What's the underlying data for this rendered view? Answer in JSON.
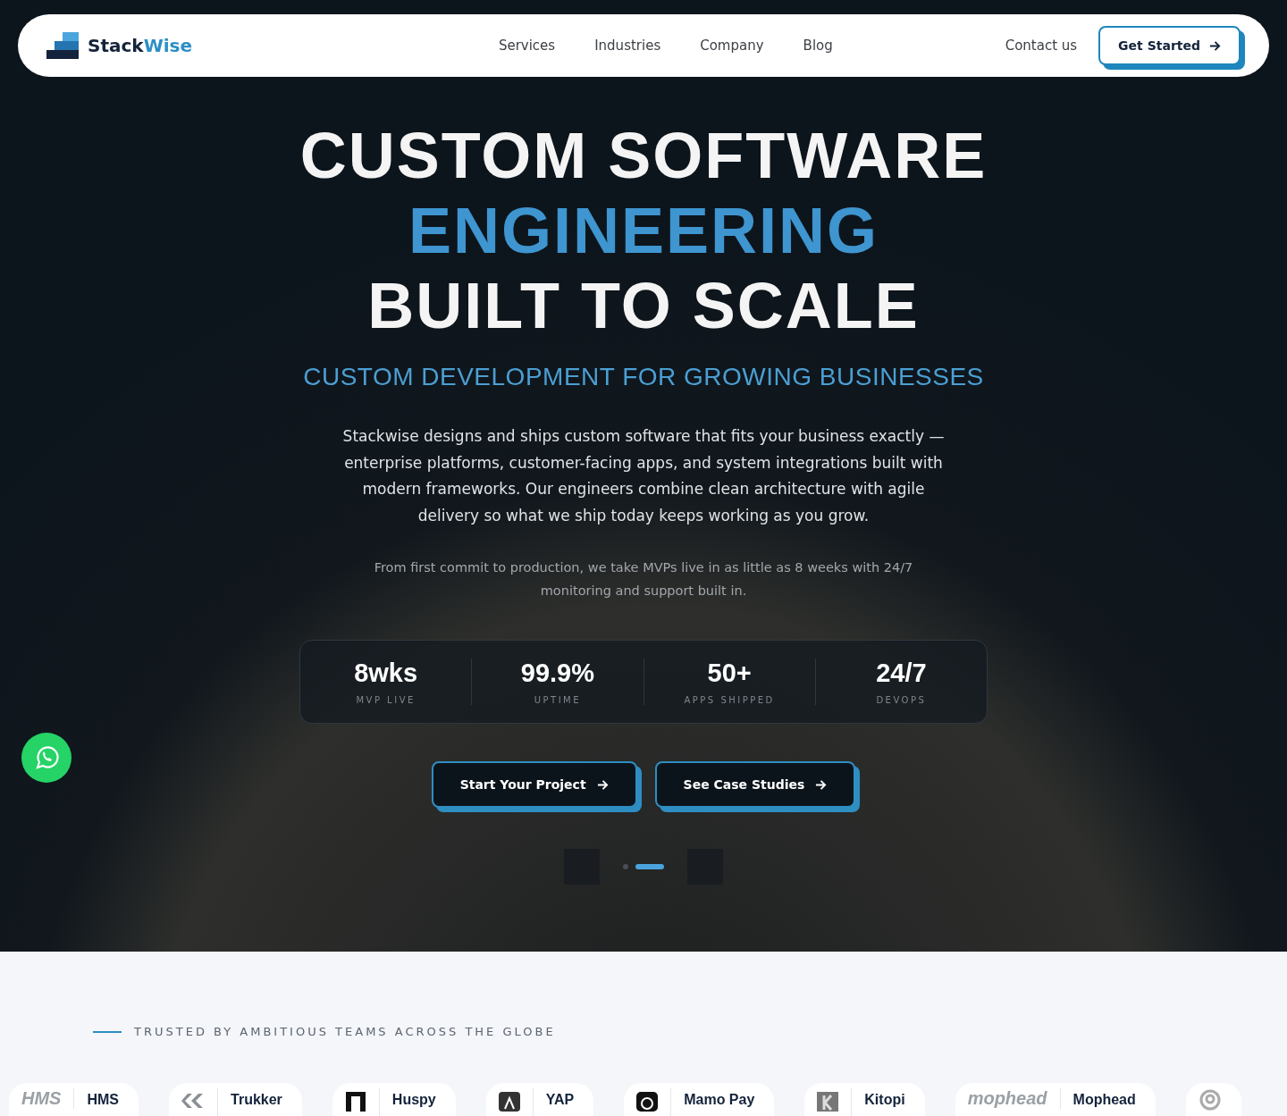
{
  "nav": {
    "brand_first": "Stack",
    "brand_second": "Wise",
    "links": [
      "Services",
      "Industries",
      "Company",
      "Blog"
    ],
    "contact": "Contact us",
    "cta": "Get Started"
  },
  "hero": {
    "title_lines": [
      {
        "text": "CUSTOM SOFTWARE",
        "kind": "plain"
      },
      {
        "text": "ENGINEERING",
        "kind": "accent"
      },
      {
        "text": "BUILT TO SCALE",
        "kind": "plain"
      }
    ],
    "subtitle": "CUSTOM DEVELOPMENT FOR GROWING BUSINESSES",
    "description": "Stackwise designs and ships custom software that fits your business exactly — enterprise platforms, customer-facing apps, and system integrations built with modern frameworks. Our engineers combine clean architecture with agile delivery so what we ship today keeps working as you grow.",
    "note": "From first commit to production, we take MVPs live in as little as 8 weeks with 24/7 monitoring and support built in.",
    "stats": [
      {
        "value": "8wks",
        "label": "MVP LIVE"
      },
      {
        "value": "99.9%",
        "label": "UPTIME"
      },
      {
        "value": "50+",
        "label": "APPS SHIPPED"
      },
      {
        "value": "24/7",
        "label": "DEVOPS"
      }
    ],
    "buttons": [
      "Start Your Project",
      "See Case Studies"
    ],
    "slides": [
      {
        "selected": false
      },
      {
        "selected": true
      }
    ]
  },
  "trusted": {
    "heading": "TRUSTED BY AMBITIOUS TEAMS ACROSS THE GLOBE",
    "clients": [
      {
        "name": "HMS",
        "logo": "HMS"
      },
      {
        "name": "Trukker"
      },
      {
        "name": "Huspy"
      },
      {
        "name": "YAP"
      },
      {
        "name": "Mamo Pay"
      },
      {
        "name": "Kitopi"
      },
      {
        "name": "Mophead",
        "logo": "mophead"
      }
    ]
  }
}
